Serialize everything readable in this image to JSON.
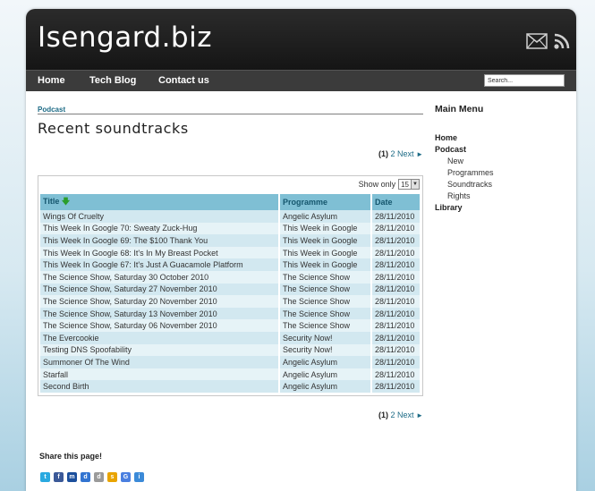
{
  "site": {
    "title": "Isengard.biz"
  },
  "header_icons": [
    "mail-icon",
    "rss-icon"
  ],
  "nav": {
    "items": [
      {
        "label": "Home"
      },
      {
        "label": "Tech Blog"
      },
      {
        "label": "Contact us"
      }
    ],
    "search_placeholder": "Search..."
  },
  "breadcrumb": "Podcast",
  "page_title": "Recent soundtracks",
  "pager": {
    "current": "(1)",
    "next_page": "2",
    "next_label": "Next",
    "arrow": "►"
  },
  "table": {
    "show_only_label": "Show only",
    "page_size": "15",
    "sort_arrow": "🡇",
    "columns": [
      "Title",
      "Programme",
      "Date"
    ],
    "rows": [
      [
        "Wings Of Cruelty",
        "Angelic Asylum",
        "28/11/2010"
      ],
      [
        "This Week In Google 70: Sweaty Zuck-Hug",
        "This Week in Google",
        "28/11/2010"
      ],
      [
        "This Week In Google 69: The $100 Thank You",
        "This Week in Google",
        "28/11/2010"
      ],
      [
        "This Week In Google 68: It's In My Breast Pocket",
        "This Week in Google",
        "28/11/2010"
      ],
      [
        "This Week In Google 67: It's Just A Guacamole Platform",
        "This Week in Google",
        "28/11/2010"
      ],
      [
        "The Science Show, Saturday 30 October 2010",
        "The Science Show",
        "28/11/2010"
      ],
      [
        "The Science Show, Saturday 27 November 2010",
        "The Science Show",
        "28/11/2010"
      ],
      [
        "The Science Show, Saturday 20 November 2010",
        "The Science Show",
        "28/11/2010"
      ],
      [
        "The Science Show, Saturday 13 November 2010",
        "The Science Show",
        "28/11/2010"
      ],
      [
        "The Science Show, Saturday 06 November 2010",
        "The Science Show",
        "28/11/2010"
      ],
      [
        "The Evercookie",
        "Security Now!",
        "28/11/2010"
      ],
      [
        "Testing DNS Spoofability",
        "Security Now!",
        "28/11/2010"
      ],
      [
        "Summoner Of The Wind",
        "Angelic Asylum",
        "28/11/2010"
      ],
      [
        "Starfall",
        "Angelic Asylum",
        "28/11/2010"
      ],
      [
        "Second Birth",
        "Angelic Asylum",
        "28/11/2010"
      ]
    ]
  },
  "sidebar": {
    "title": "Main Menu",
    "items": [
      {
        "label": "Home",
        "level": 0
      },
      {
        "label": "Podcast",
        "level": 0
      },
      {
        "label": "New",
        "level": 1
      },
      {
        "label": "Programmes",
        "level": 1
      },
      {
        "label": "Soundtracks",
        "level": 1
      },
      {
        "label": "Rights",
        "level": 1
      },
      {
        "label": "Library",
        "level": 0
      }
    ]
  },
  "share": {
    "title": "Share this page!",
    "icons": [
      {
        "name": "twitter-icon",
        "glyph": "t",
        "color": "#2aa9e0"
      },
      {
        "name": "facebook-icon",
        "glyph": "f",
        "color": "#3b5998"
      },
      {
        "name": "myspace-icon",
        "glyph": "m",
        "color": "#1c4f9c"
      },
      {
        "name": "delicious-icon",
        "glyph": "d",
        "color": "#3274d1"
      },
      {
        "name": "digg-icon",
        "glyph": "d",
        "color": "#9a9a9a"
      },
      {
        "name": "stumbleupon-icon",
        "glyph": "s",
        "color": "#e9a400"
      },
      {
        "name": "google-icon",
        "glyph": "G",
        "color": "#4a7fe0"
      },
      {
        "name": "hi5-icon",
        "glyph": "i",
        "color": "#3b8ad8"
      }
    ]
  },
  "colors": {
    "header_bg": "#1b1b1b",
    "nav_bg": "#3b3b3b",
    "link": "#1d6b86",
    "table_header_bg": "#7fbfd4",
    "row_odd": "#d2e8f0",
    "row_even": "#e6f3f7"
  }
}
